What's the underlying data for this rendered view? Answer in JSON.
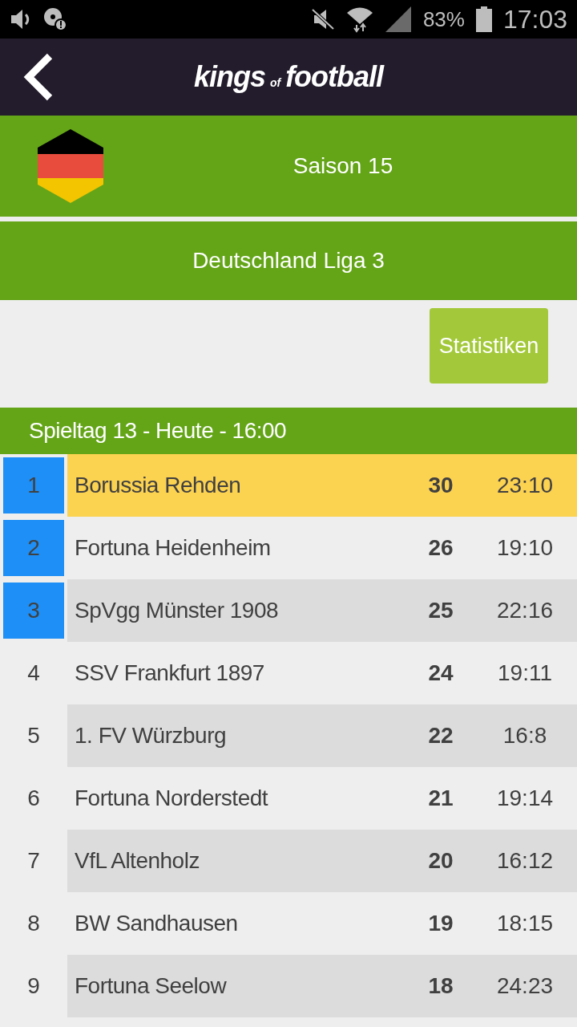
{
  "status_bar": {
    "battery": "83%",
    "time": "17:03"
  },
  "app_bar": {
    "logo_parts": [
      "kings",
      "of",
      "football"
    ]
  },
  "season": {
    "title": "Saison 15"
  },
  "league": {
    "title": "Deutschland Liga 3"
  },
  "buttons": [
    "Statistiken"
  ],
  "matchday": {
    "title": "Spieltag 13 - Heute - 16:00"
  },
  "table": {
    "rows": [
      {
        "rank": "1",
        "team": "Borussia Rehden",
        "points": "30",
        "goals": "23:10",
        "promotion": true,
        "selected": true
      },
      {
        "rank": "2",
        "team": "Fortuna Heidenheim",
        "points": "26",
        "goals": "19:10",
        "promotion": true,
        "selected": false
      },
      {
        "rank": "3",
        "team": "SpVgg Münster 1908",
        "points": "25",
        "goals": "22:16",
        "promotion": true,
        "selected": false
      },
      {
        "rank": "4",
        "team": "SSV Frankfurt 1897",
        "points": "24",
        "goals": "19:11",
        "promotion": false,
        "selected": false
      },
      {
        "rank": "5",
        "team": "1. FV Würzburg",
        "points": "22",
        "goals": "16:8",
        "promotion": false,
        "selected": false
      },
      {
        "rank": "6",
        "team": "Fortuna Norderstedt",
        "points": "21",
        "goals": "19:14",
        "promotion": false,
        "selected": false
      },
      {
        "rank": "7",
        "team": "VfL Altenholz",
        "points": "20",
        "goals": "16:12",
        "promotion": false,
        "selected": false
      },
      {
        "rank": "8",
        "team": "BW Sandhausen",
        "points": "19",
        "goals": "18:15",
        "promotion": false,
        "selected": false
      },
      {
        "rank": "9",
        "team": "Fortuna Seelow",
        "points": "18",
        "goals": "24:23",
        "promotion": false,
        "selected": false
      }
    ]
  }
}
